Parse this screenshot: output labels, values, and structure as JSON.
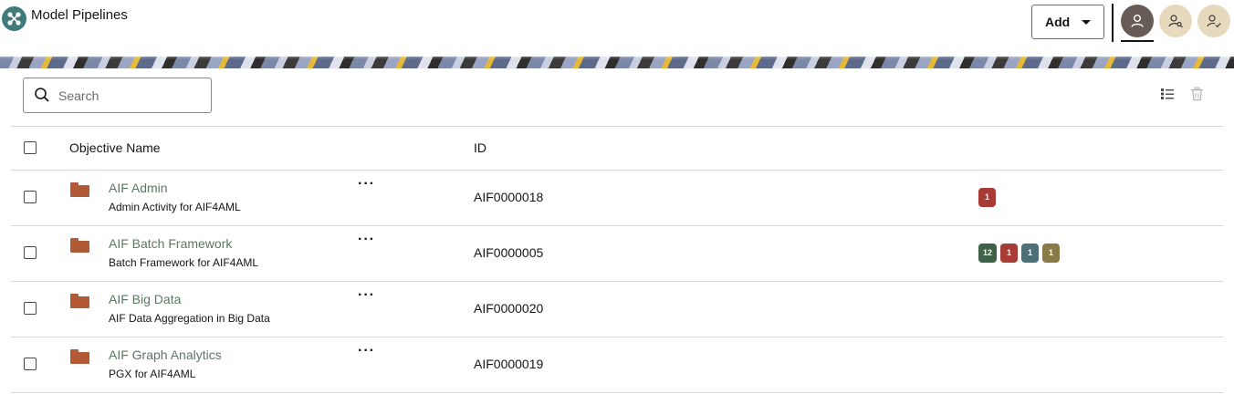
{
  "header": {
    "title": "Model Pipelines",
    "add_label": "Add"
  },
  "search": {
    "placeholder": "Search"
  },
  "table": {
    "columns": {
      "name": "Objective Name",
      "id": "ID"
    },
    "rows": [
      {
        "name": "AIF Admin",
        "description": "Admin Activity for AIF4AML",
        "id": "AIF0000018",
        "menu": "···",
        "badges": [
          {
            "value": "1",
            "color": "#a93b37"
          }
        ]
      },
      {
        "name": "AIF Batch Framework",
        "description": "Batch Framework for AIF4AML",
        "id": "AIF0000005",
        "menu": "···",
        "badges": [
          {
            "value": "12",
            "color": "#3f6147"
          },
          {
            "value": "1",
            "color": "#a93b37"
          },
          {
            "value": "1",
            "color": "#4c6f78"
          },
          {
            "value": "1",
            "color": "#8a7a48"
          }
        ]
      },
      {
        "name": "AIF Big Data",
        "description": "AIF Data Aggregation in Big Data",
        "id": "AIF0000020",
        "menu": "···",
        "badges": []
      },
      {
        "name": "AIF Graph Analytics",
        "description": "PGX for AIF4AML",
        "id": "AIF0000019",
        "menu": "···",
        "badges": []
      }
    ]
  },
  "colors": {
    "folder": "#b15a35",
    "link_text": "#5b7763",
    "logo": "#3f7a7c",
    "persona_active": "#665c55",
    "persona_inactive": "#e6d9bd"
  }
}
